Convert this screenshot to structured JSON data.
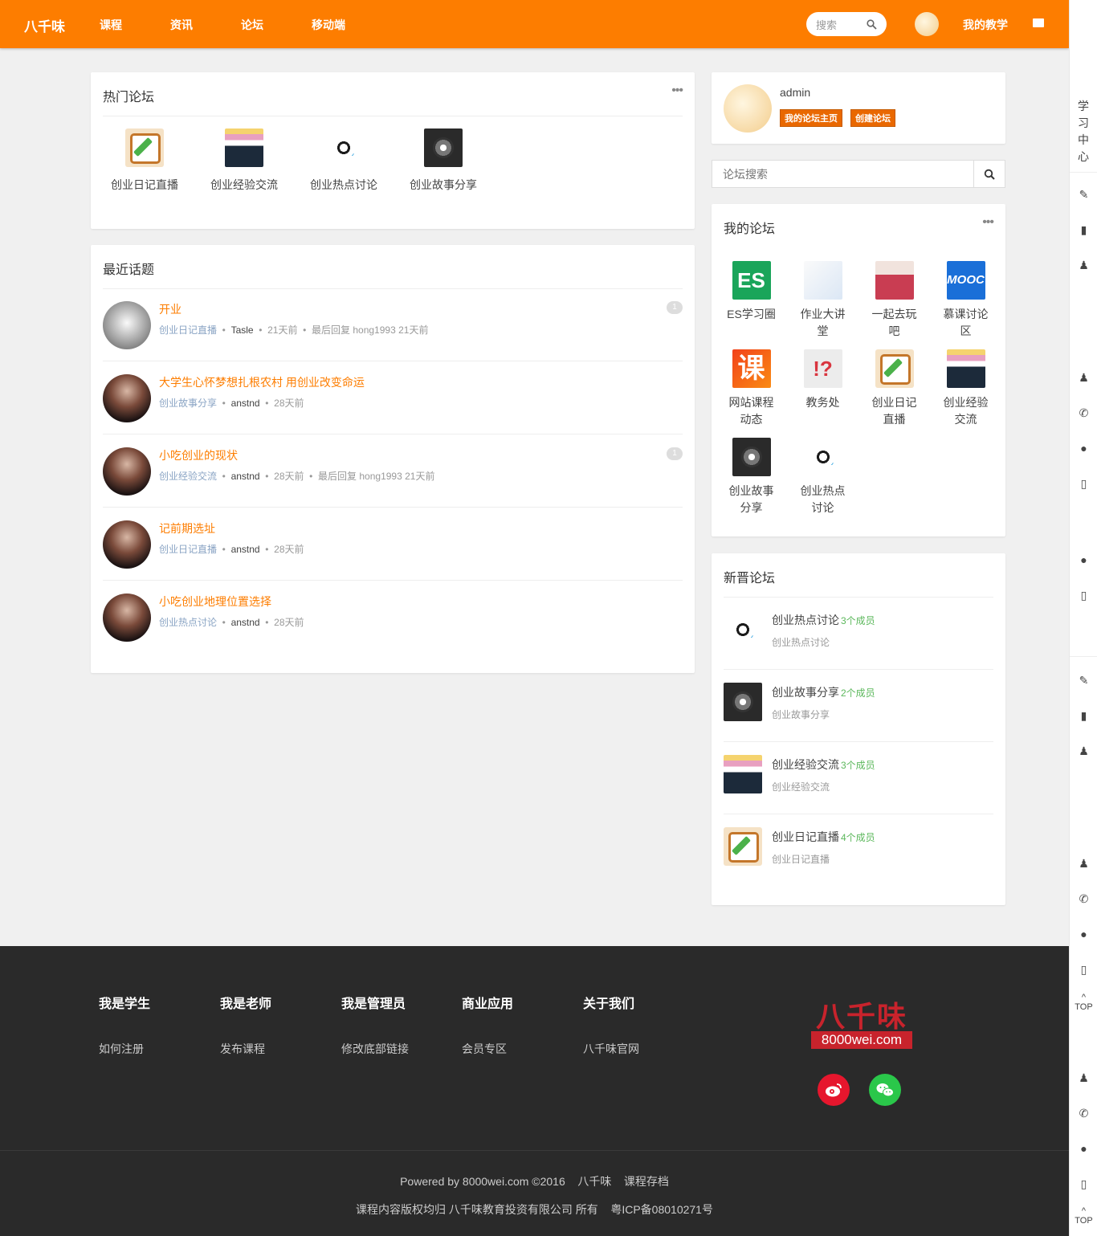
{
  "topbar": {
    "logo": "八千味",
    "nav": [
      "课程",
      "资讯",
      "论坛",
      "移动端"
    ],
    "search_placeholder": "搜索",
    "my_teaching": "我的教学"
  },
  "hot_forums": {
    "title": "热门论坛",
    "items": [
      {
        "label": "创业日记直播",
        "icon": "diary-icon"
      },
      {
        "label": "创业经验交流",
        "icon": "people-icon"
      },
      {
        "label": "创业热点讨论",
        "icon": "hot-topic-icon"
      },
      {
        "label": "创业故事分享",
        "icon": "story-icon"
      }
    ]
  },
  "recent_topics": {
    "title": "最近话题",
    "items": [
      {
        "title": "开业",
        "forum": "创业日记直播",
        "user": "Tasle",
        "time": "21天前",
        "reply": "最后回复 hong1993 21天前",
        "count": "1"
      },
      {
        "title": "大学生心怀梦想扎根农村 用创业改变命运",
        "forum": "创业故事分享",
        "user": "anstnd",
        "time": "28天前",
        "reply": "",
        "count": ""
      },
      {
        "title": "小吃创业的现状",
        "forum": "创业经验交流",
        "user": "anstnd",
        "time": "28天前",
        "reply": "最后回复 hong1993 21天前",
        "count": "1"
      },
      {
        "title": "记前期选址",
        "forum": "创业日记直播",
        "user": "anstnd",
        "time": "28天前",
        "reply": "",
        "count": ""
      },
      {
        "title": "小吃创业地理位置选择",
        "forum": "创业热点讨论",
        "user": "anstnd",
        "time": "28天前",
        "reply": "",
        "count": ""
      }
    ]
  },
  "user_card": {
    "name": "admin",
    "btn_home": "我的论坛主页",
    "btn_create": "创建论坛"
  },
  "forum_search": {
    "placeholder": "论坛搜索"
  },
  "my_forums": {
    "title": "我的论坛",
    "items": [
      {
        "label": "ES学习圈",
        "icon": "es-icon"
      },
      {
        "label": "作业大讲堂",
        "icon": "homework-icon"
      },
      {
        "label": "一起去玩吧",
        "icon": "travel-icon"
      },
      {
        "label": "慕课讨论区",
        "icon": "mooc-icon"
      },
      {
        "label": "网站课程动态",
        "icon": "course-icon"
      },
      {
        "label": "教务处",
        "icon": "question-icon"
      },
      {
        "label": "创业日记直播",
        "icon": "diary-icon"
      },
      {
        "label": "创业经验交流",
        "icon": "people-icon"
      },
      {
        "label": "创业故事分享",
        "icon": "story-icon"
      },
      {
        "label": "创业热点讨论",
        "icon": "hot-topic-icon"
      }
    ]
  },
  "new_forums": {
    "title": "新晋论坛",
    "items": [
      {
        "name": "创业热点讨论",
        "members": "3个成员",
        "desc": "创业热点讨论",
        "icon": "hot-topic-icon"
      },
      {
        "name": "创业故事分享",
        "members": "2个成员",
        "desc": "创业故事分享",
        "icon": "story-icon"
      },
      {
        "name": "创业经验交流",
        "members": "3个成员",
        "desc": "创业经验交流",
        "icon": "people-icon"
      },
      {
        "name": "创业日记直播",
        "members": "4个成员",
        "desc": "创业日记直播",
        "icon": "diary-icon"
      }
    ]
  },
  "footer": {
    "columns": [
      {
        "title": "我是学生",
        "link": "如何注册"
      },
      {
        "title": "我是老师",
        "link": "发布课程"
      },
      {
        "title": "我是管理员",
        "link": "修改底部链接"
      },
      {
        "title": "商业应用",
        "link": "会员专区"
      },
      {
        "title": "关于我们",
        "link": "八千味官网"
      }
    ],
    "logo_text": "八千味",
    "logo_domain": "8000wei.com",
    "powered": "Powered by 8000wei.com ©2016",
    "brand": "八千味",
    "archive": "课程存档",
    "copyright": "课程内容版权均归 八千味教育投资有限公司 所有",
    "icp": "粤ICP备08010271号"
  },
  "sidebar": {
    "study_center": "学习中心",
    "top": "TOP"
  },
  "colors": {
    "primary": "#fd7d00",
    "footer": "#2a2a2a",
    "member": "#5cb85c"
  }
}
